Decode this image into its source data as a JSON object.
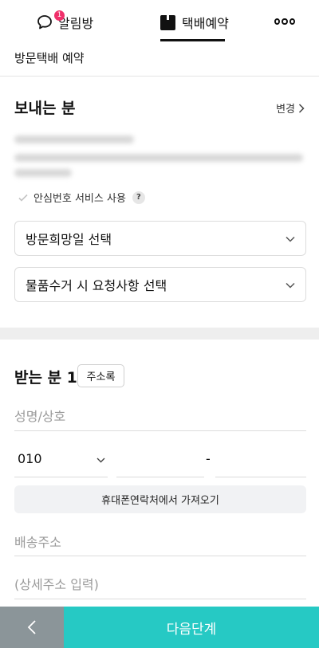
{
  "tabs": {
    "alarm": {
      "label": "알림방",
      "badge": "1"
    },
    "booking": {
      "label": "택배예약"
    },
    "more_icon": "more-icon"
  },
  "page": {
    "title": "방문택배 예약"
  },
  "sender": {
    "title": "보내는 분",
    "change_label": "변경",
    "safe_number_label": "안심번호 서비스 사용",
    "help_label": "?",
    "visit_date_select": "방문희망일 선택",
    "pickup_request_select": "물품수거 시 요청사항 선택"
  },
  "receiver": {
    "title": "받는 분 1",
    "address_book_button": "주소록",
    "name_placeholder": "성명/상호",
    "phone_prefix": "010",
    "phone_dash": "-",
    "import_contact_button": "휴대폰연락처에서 가져오기",
    "address_placeholder": "배송주소",
    "detail_address_placeholder": "(상세주소 입력)"
  },
  "bottom": {
    "next_label": "다음단계"
  },
  "colors": {
    "accent": "#26c9c4",
    "badge": "#f0306b",
    "back": "#8b9599"
  }
}
